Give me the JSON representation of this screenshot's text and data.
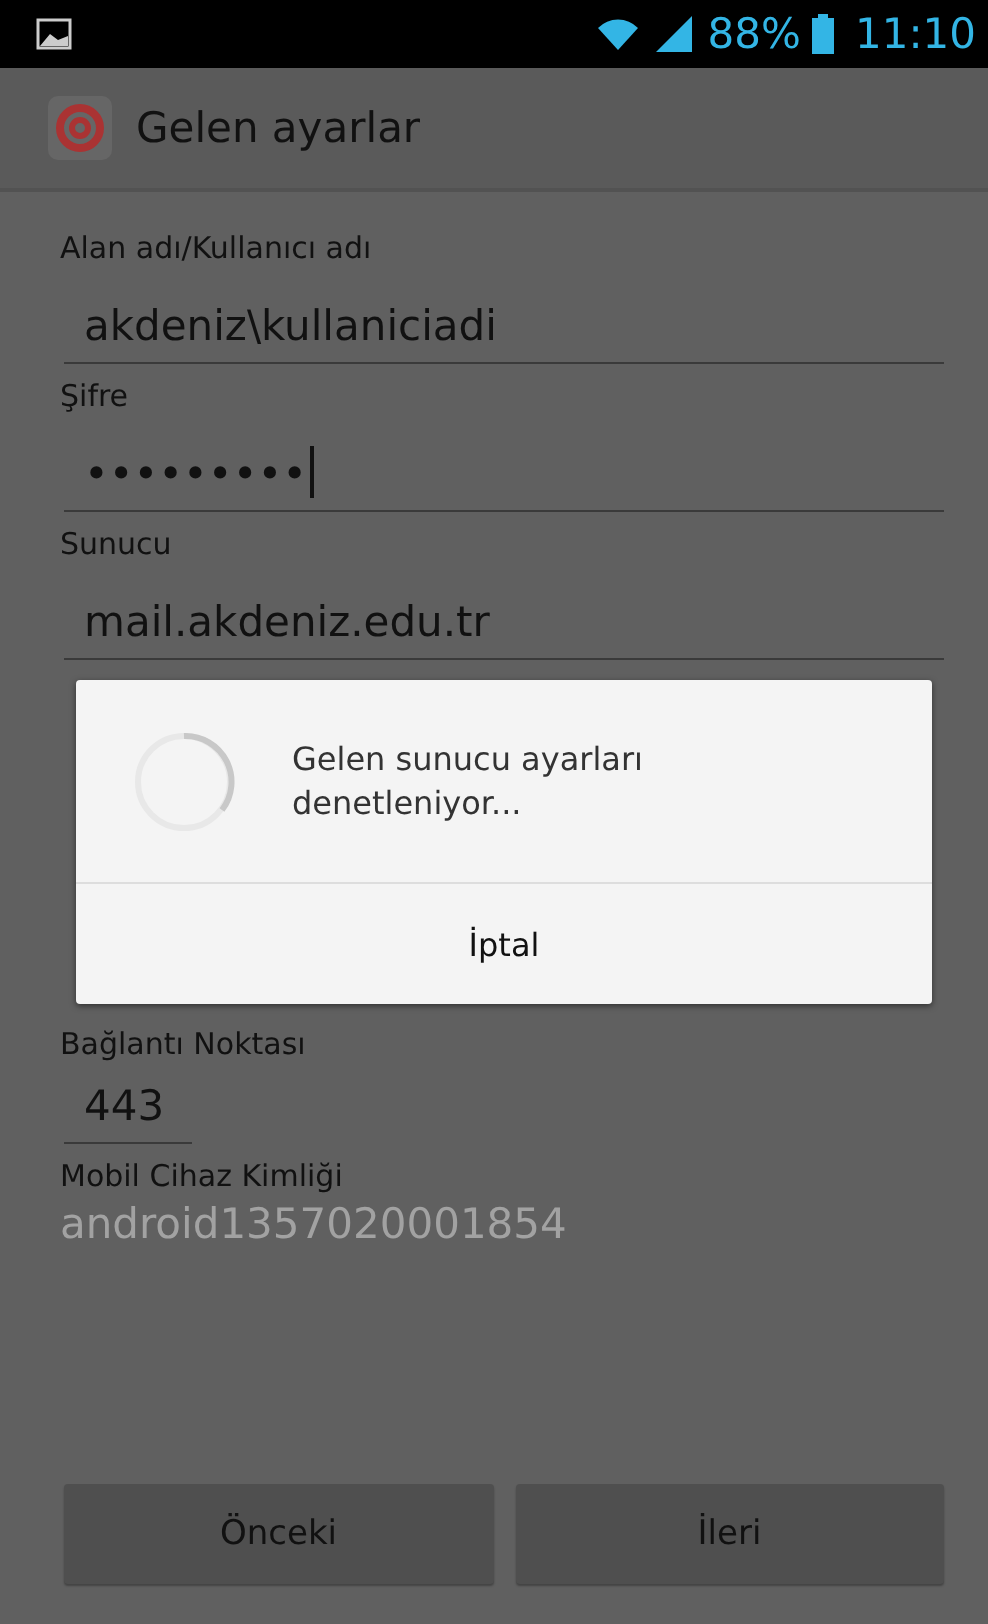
{
  "status_bar": {
    "battery": "88%",
    "time": "11:10"
  },
  "title_bar": {
    "title": "Gelen ayarlar"
  },
  "fields": [
    {
      "label": "Alan adı/Kullanıcı adı",
      "value": "akdeniz\\kullaniciadi",
      "kind": "text"
    },
    {
      "label": "Şifre",
      "value": "•••••••••",
      "kind": "password"
    },
    {
      "label": "Sunucu",
      "value": "mail.akdeniz.edu.tr",
      "kind": "text"
    }
  ],
  "port": {
    "label": "Bağlantı Noktası",
    "value": "443"
  },
  "device_id": {
    "label": "Mobil Cihaz Kimliği",
    "value": "android1357020001854"
  },
  "dialog": {
    "message": "Gelen sunucu ayarları denetleniyor...",
    "button": "İptal"
  },
  "buttons": [
    {
      "label": "Önceki"
    },
    {
      "label": "İleri"
    }
  ]
}
